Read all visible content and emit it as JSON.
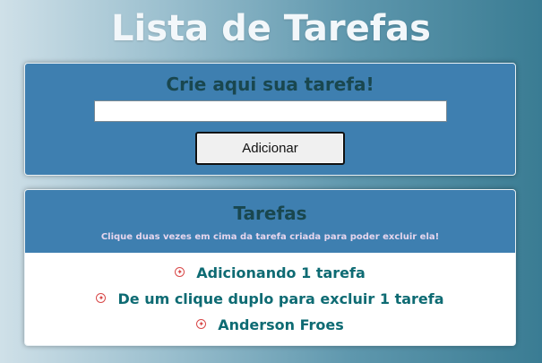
{
  "page": {
    "title": "Lista de Tarefas"
  },
  "create": {
    "heading": "Crie aqui sua tarefa!",
    "input_value": "",
    "input_placeholder": "",
    "button_label": "Adicionar"
  },
  "list": {
    "heading": "Tarefas",
    "hint": "Clique duas vezes em cima da tarefa criada para poder excluir ela!",
    "items": [
      {
        "label": "Adicionando 1 tarefa",
        "icon": "star-circle-icon"
      },
      {
        "label": "De um clique duplo para excluir 1 tarefa",
        "icon": "star-circle-icon"
      },
      {
        "label": "Anderson Froes",
        "icon": "star-circle-icon"
      }
    ]
  },
  "colors": {
    "panel": "#3e7fb0",
    "heading_text": "#19474f",
    "task_text": "#0e6b73",
    "bullet": "#d84848"
  }
}
